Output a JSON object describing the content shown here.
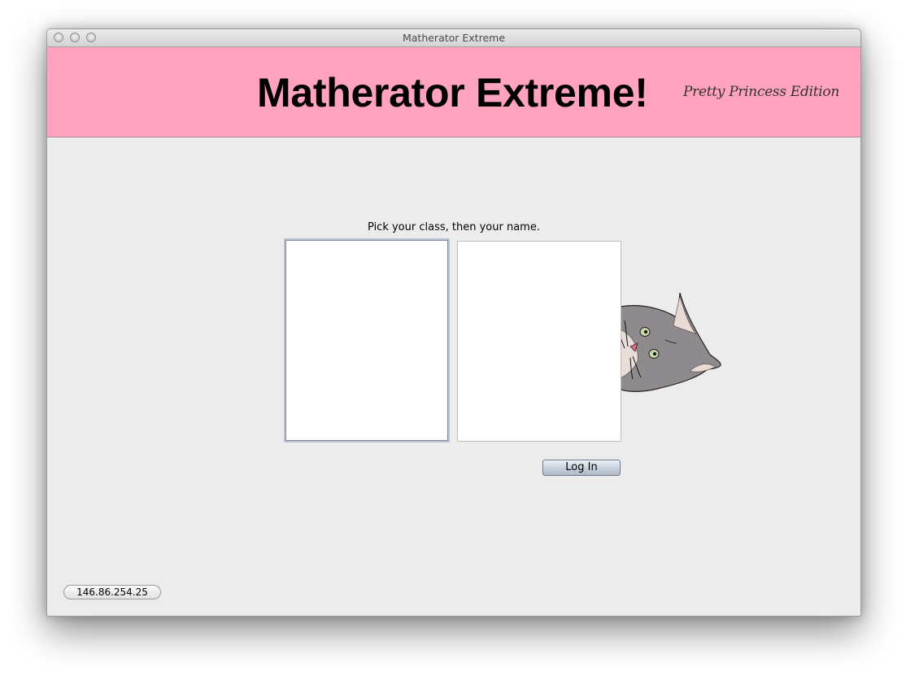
{
  "window": {
    "title": "Matherator Extreme",
    "controls": [
      "close-button",
      "minimize-button",
      "zoom-button"
    ]
  },
  "header": {
    "title": "Matherator Extreme!",
    "subtitle": "Pretty Princess Edition",
    "background_color": "#ffa3bf"
  },
  "login": {
    "instruction": "Pick your class, then your name.",
    "class_list": {
      "items": []
    },
    "name_list": {
      "items": []
    },
    "login_label": "Log In"
  },
  "mascot": {
    "icon": "cat-peeking-icon"
  },
  "status": {
    "ip_address": "146.86.254.25"
  }
}
